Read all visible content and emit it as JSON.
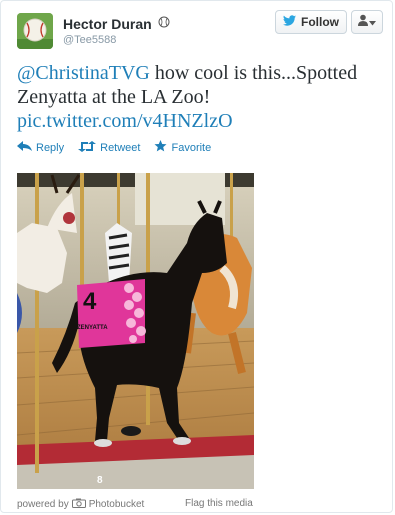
{
  "user": {
    "full_name": "Hector Duran",
    "handle": "@Tee5588"
  },
  "follow_button": {
    "label": "Follow"
  },
  "tweet": {
    "mention": "@ChristinaTVG",
    "text": " how cool is this...Spotted Zenyatta at the LA Zoo!",
    "link": "pic.twitter.com/v4HNZlzO"
  },
  "actions": {
    "reply": "Reply",
    "retweet": "Retweet",
    "favorite": "Favorite"
  },
  "media": {
    "saddle_number": "4",
    "saddle_name": "ZENYATTA",
    "platform_number": "8"
  },
  "footer": {
    "powered_by": "powered by",
    "provider": "Photobucket",
    "flag": "Flag this media"
  },
  "colors": {
    "link": "#1f7fb8",
    "accent_blue": "#2ba6e1",
    "saddle_pink": "#e0369a"
  }
}
